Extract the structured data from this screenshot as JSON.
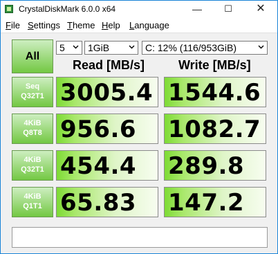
{
  "window": {
    "title": "CrystalDiskMark 6.0.0 x64"
  },
  "titlebar_buttons": {
    "minimize": "—",
    "maximize": "☐",
    "close": "✕"
  },
  "menu": [
    {
      "label": "File",
      "accel": "F",
      "rest": "ile"
    },
    {
      "label": "Settings",
      "accel": "S",
      "rest": "ettings"
    },
    {
      "label": "Theme",
      "accel": "T",
      "rest": "heme"
    },
    {
      "label": "Help",
      "accel": "H",
      "rest": "elp"
    },
    {
      "label": "Language",
      "accel": "L",
      "rest": "anguage"
    }
  ],
  "controls": {
    "all_button": "All",
    "count": "5",
    "size": "1GiB",
    "drive": "C: 12% (116/953GiB)"
  },
  "headers": {
    "read": "Read [MB/s]",
    "write": "Write [MB/s]"
  },
  "tests": [
    {
      "line1": "Seq",
      "line2": "Q32T1",
      "read": "3005.4",
      "write": "1544.6"
    },
    {
      "line1": "4KiB",
      "line2": "Q8T8",
      "read": "956.6",
      "write": "1082.7"
    },
    {
      "line1": "4KiB",
      "line2": "Q32T1",
      "read": "454.4",
      "write": "289.8"
    },
    {
      "line1": "4KiB",
      "line2": "Q1T1",
      "read": "65.83",
      "write": "147.2"
    }
  ],
  "status": {
    "text": ""
  },
  "colors": {
    "accent_green": "#73c843",
    "window_border": "#1883d7"
  }
}
